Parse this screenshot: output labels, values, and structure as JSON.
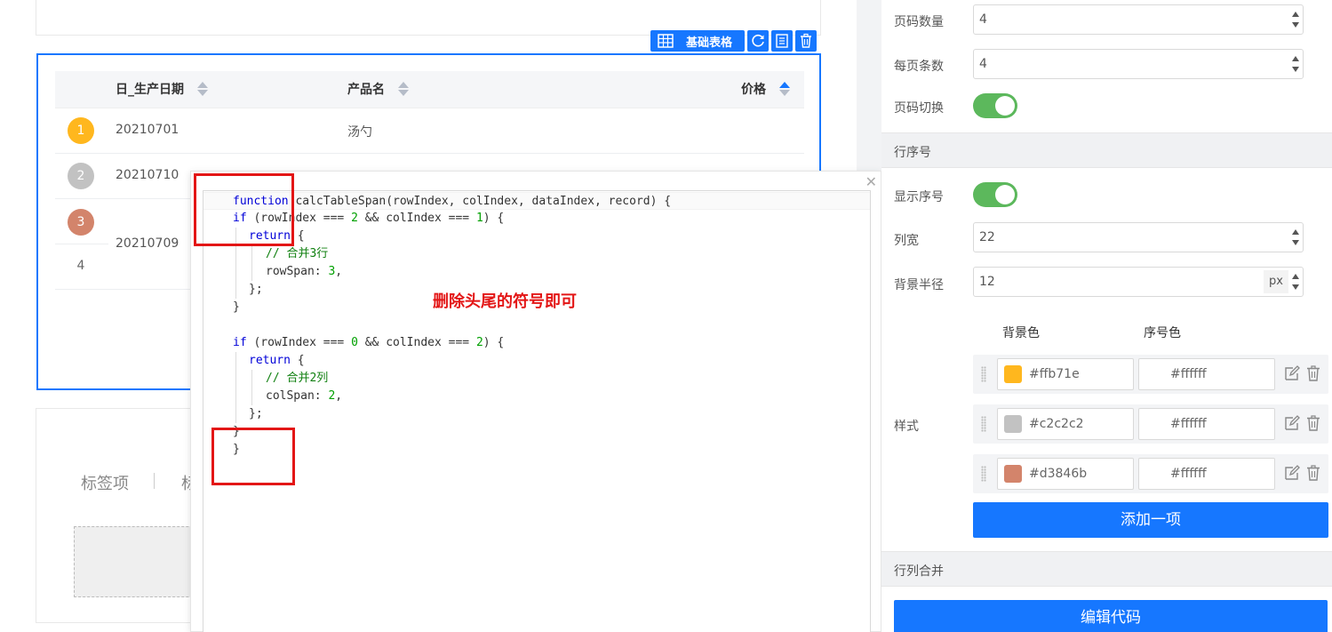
{
  "canvas": {
    "toolbar": {
      "component_label": "基础表格"
    },
    "table": {
      "columns": [
        "日_生产日期",
        "产品名",
        "价格"
      ],
      "rows": [
        {
          "seq": "1",
          "date": "20210701",
          "product": "汤勺",
          "seq_color": "#ffb71e"
        },
        {
          "seq": "2",
          "date": "20210710",
          "product": "",
          "seq_color": "#c2c2c2"
        },
        {
          "seq": "3",
          "date": "20210709",
          "product": "",
          "seq_color": "#d3846b"
        },
        {
          "seq": "4",
          "date": "",
          "product": ""
        }
      ]
    },
    "tabs": [
      "标签项",
      "标"
    ]
  },
  "code_popup": {
    "lines": [
      "function calcTableSpan(rowIndex, colIndex, dataIndex, record) {",
      "if (rowIndex === 2 && colIndex === 1) {",
      "  return {",
      "    // 合并3行",
      "    rowSpan: 3,",
      "  };",
      "}",
      "",
      "if (rowIndex === 0 && colIndex === 2) {",
      "  return {",
      "    // 合并2列",
      "    colSpan: 2,",
      "  };",
      "}",
      "}"
    ],
    "annotation": "删除头尾的符号即可",
    "annotation_color": "#e31616"
  },
  "panel": {
    "page_count_label": "页码数量",
    "page_count_value": "4",
    "page_size_label": "每页条数",
    "page_size_value": "4",
    "page_switch_label": "页码切换",
    "page_switch_on": true,
    "row_number_section": "行序号",
    "show_number_label": "显示序号",
    "show_number_on": true,
    "col_width_label": "列宽",
    "col_width_value": "22",
    "radius_label": "背景半径",
    "radius_value": "12",
    "radius_unit": "px",
    "bg_color_header": "背景色",
    "num_color_header": "序号色",
    "style_label": "样式",
    "styles": [
      {
        "bg": "#ffb71e",
        "fg": "#ffffff"
      },
      {
        "bg": "#c2c2c2",
        "fg": "#ffffff"
      },
      {
        "bg": "#d3846b",
        "fg": "#ffffff"
      }
    ],
    "add_button": "添加一项",
    "merge_section": "行列合并",
    "edit_code_button": "编辑代码"
  },
  "colors": {
    "accent": "#1677ff",
    "switch_on": "#5cb85c"
  }
}
